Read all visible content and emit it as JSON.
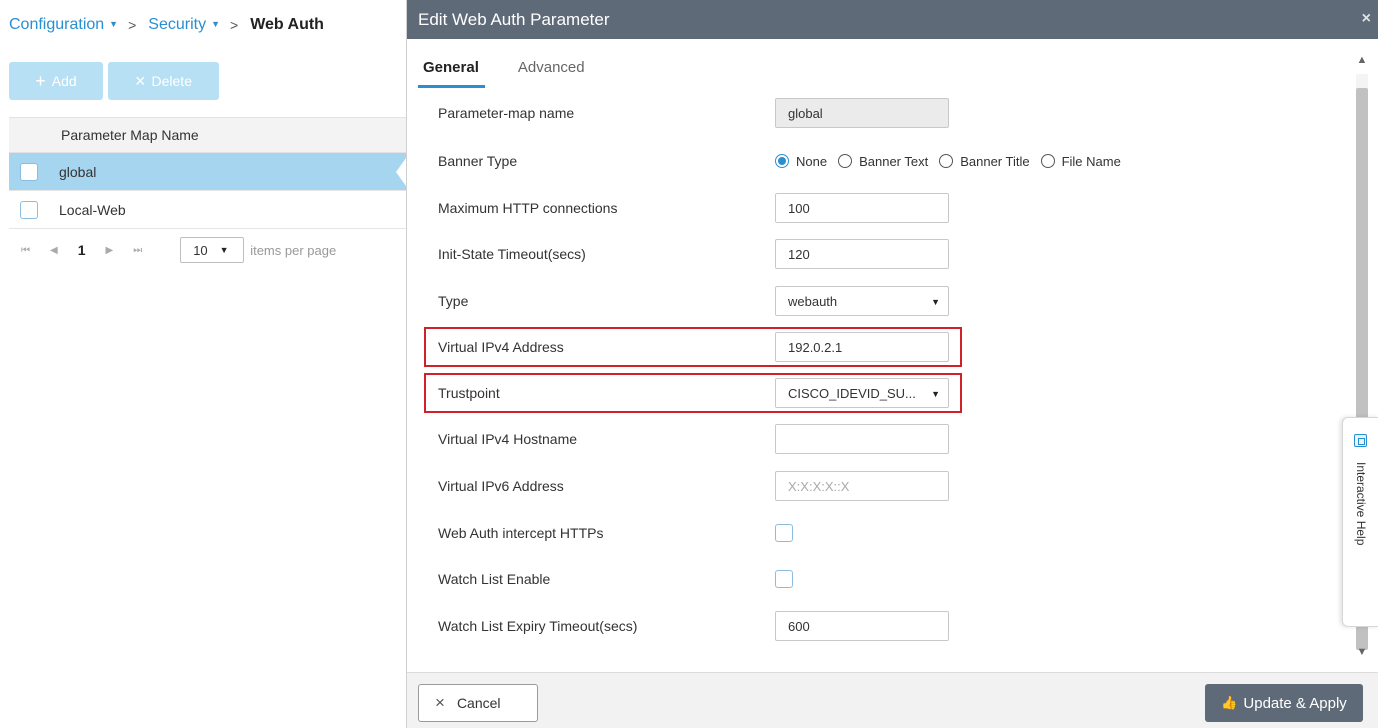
{
  "breadcrumb": {
    "items": [
      "Configuration",
      "Security"
    ],
    "separator": ">",
    "current": "Web Auth"
  },
  "toolbar": {
    "add_icon": "+",
    "add_label": "Add",
    "delete_icon": "×",
    "delete_label": "Delete"
  },
  "grid": {
    "column_header": "Parameter Map Name",
    "rows": [
      "global",
      "Local-Web"
    ],
    "selected_row": "global"
  },
  "pager": {
    "first_icon": "⏮",
    "prev_icon": "◀",
    "page": "1",
    "next_icon": "▶",
    "last_icon": "⏭",
    "page_size": "10",
    "page_size_label": "items per page"
  },
  "modal": {
    "title": "Edit Web Auth Parameter",
    "close_icon": "×",
    "tabs": [
      {
        "label": "General",
        "active": true
      },
      {
        "label": "Advanced",
        "active": false
      }
    ],
    "fields": {
      "parameter_map_name": {
        "label": "Parameter-map name",
        "value": "global"
      },
      "banner_type": {
        "label": "Banner Type",
        "options": [
          "None",
          "Banner Text",
          "Banner Title",
          "File Name"
        ],
        "selected": "None"
      },
      "max_http": {
        "label": "Maximum HTTP connections",
        "value": "100"
      },
      "init_state": {
        "label": "Init-State Timeout(secs)",
        "value": "120"
      },
      "type": {
        "label": "Type",
        "value": "webauth"
      },
      "virtual_ipv4": {
        "label": "Virtual IPv4 Address",
        "value": "192.0.2.1"
      },
      "trustpoint": {
        "label": "Trustpoint",
        "value": "CISCO_IDEVID_SU..."
      },
      "virtual_ipv4_hostname": {
        "label": "Virtual IPv4 Hostname",
        "value": ""
      },
      "virtual_ipv6": {
        "label": "Virtual IPv6 Address",
        "value": "",
        "placeholder": "X:X:X:X::X"
      },
      "intercept_https": {
        "label": "Web Auth intercept HTTPs",
        "checked": false
      },
      "watch_list_enable": {
        "label": "Watch List Enable",
        "checked": false
      },
      "watch_list_expiry": {
        "label": "Watch List Expiry Timeout(secs)",
        "value": "600"
      }
    },
    "help": {
      "label": "Interactive Help"
    },
    "footer": {
      "cancel_icon": "×",
      "cancel_label": "Cancel",
      "update_icon": "👍",
      "update_label": "Update & Apply"
    }
  },
  "colors": {
    "accent": "#2a8fd0",
    "header_bg": "#5f6a78",
    "highlight": "#d0202a",
    "selected_row": "#a6d5ef"
  }
}
